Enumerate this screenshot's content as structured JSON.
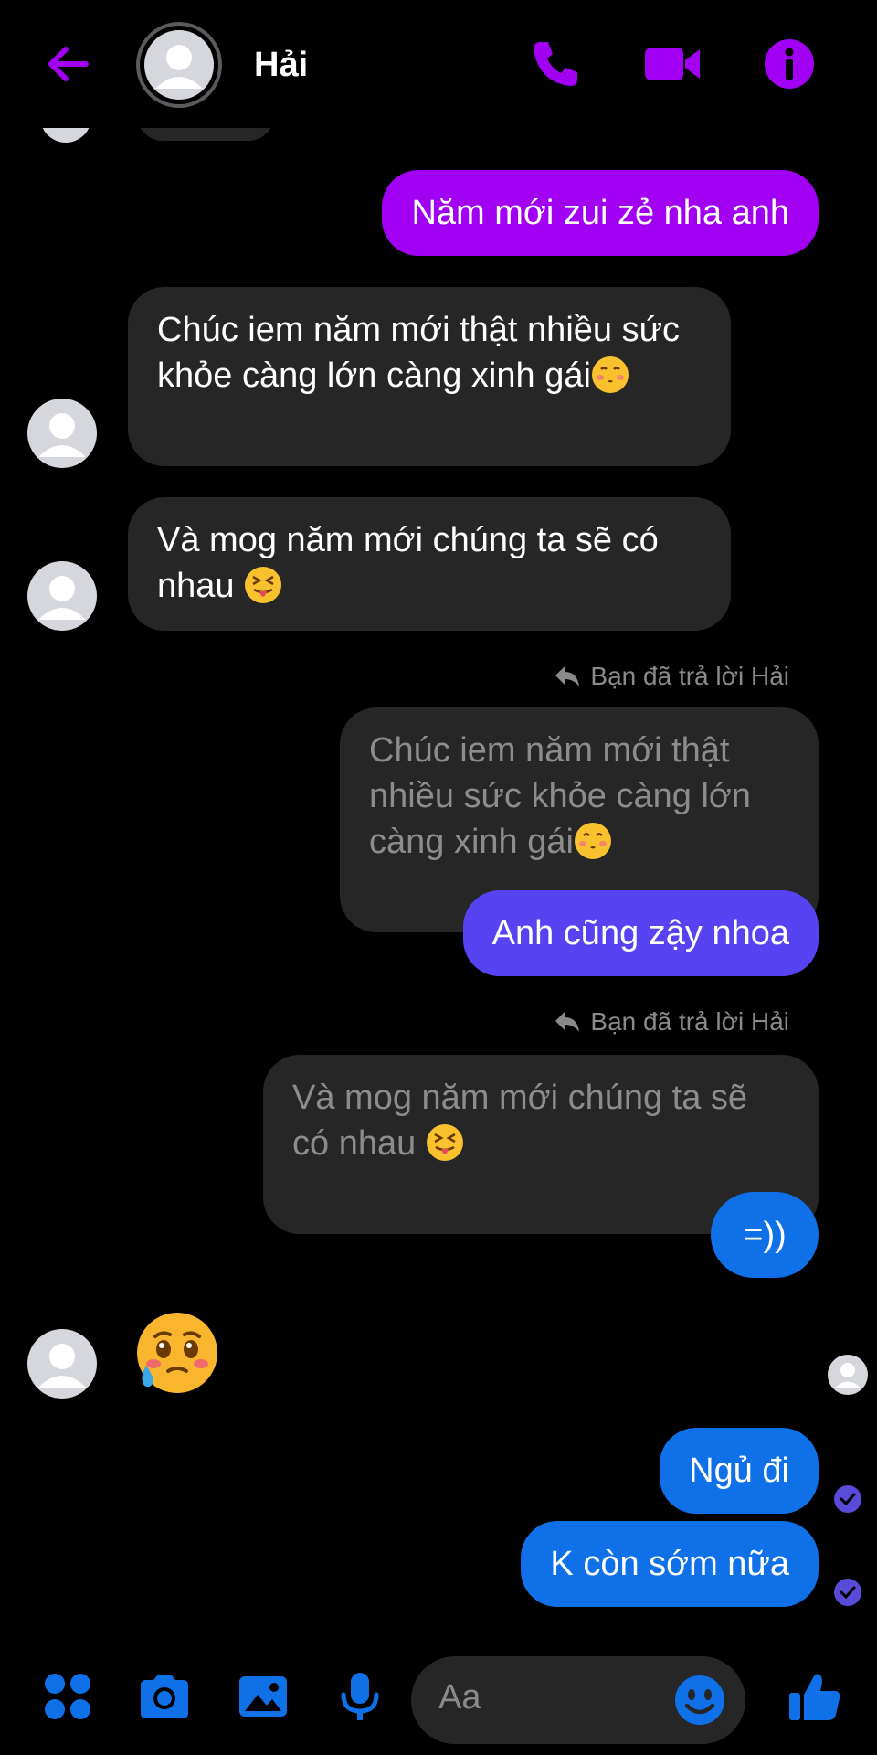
{
  "header": {
    "contact_name": "Hải"
  },
  "messages": {
    "m1": "Năm mới zui zẻ nha anh",
    "m2": "Chúc iem năm mới thật nhiều sức khỏe càng lớn càng xinh gái",
    "m3": "Và mog năm mới chúng ta sẽ có nhau",
    "reply_note_1": "Bạn đã trả lời Hải",
    "quote_1": "Chúc iem năm mới thật nhiều sức khỏe càng lớn càng xinh gái",
    "m4": "Anh cũng zậy nhoa",
    "reply_note_2": "Bạn đã trả lời Hải",
    "quote_2": "Và mog năm mới chúng ta sẽ có nhau",
    "m5": "=))",
    "m6": "Ngủ đi",
    "m7": "K còn sớm nữa"
  },
  "composer": {
    "placeholder": "Aa"
  },
  "colors": {
    "accent": "#a100f2",
    "indigo": "#5743f2",
    "blue": "#0f70e8",
    "incoming": "#262626",
    "emoji_yellow": "#f9c12e"
  }
}
